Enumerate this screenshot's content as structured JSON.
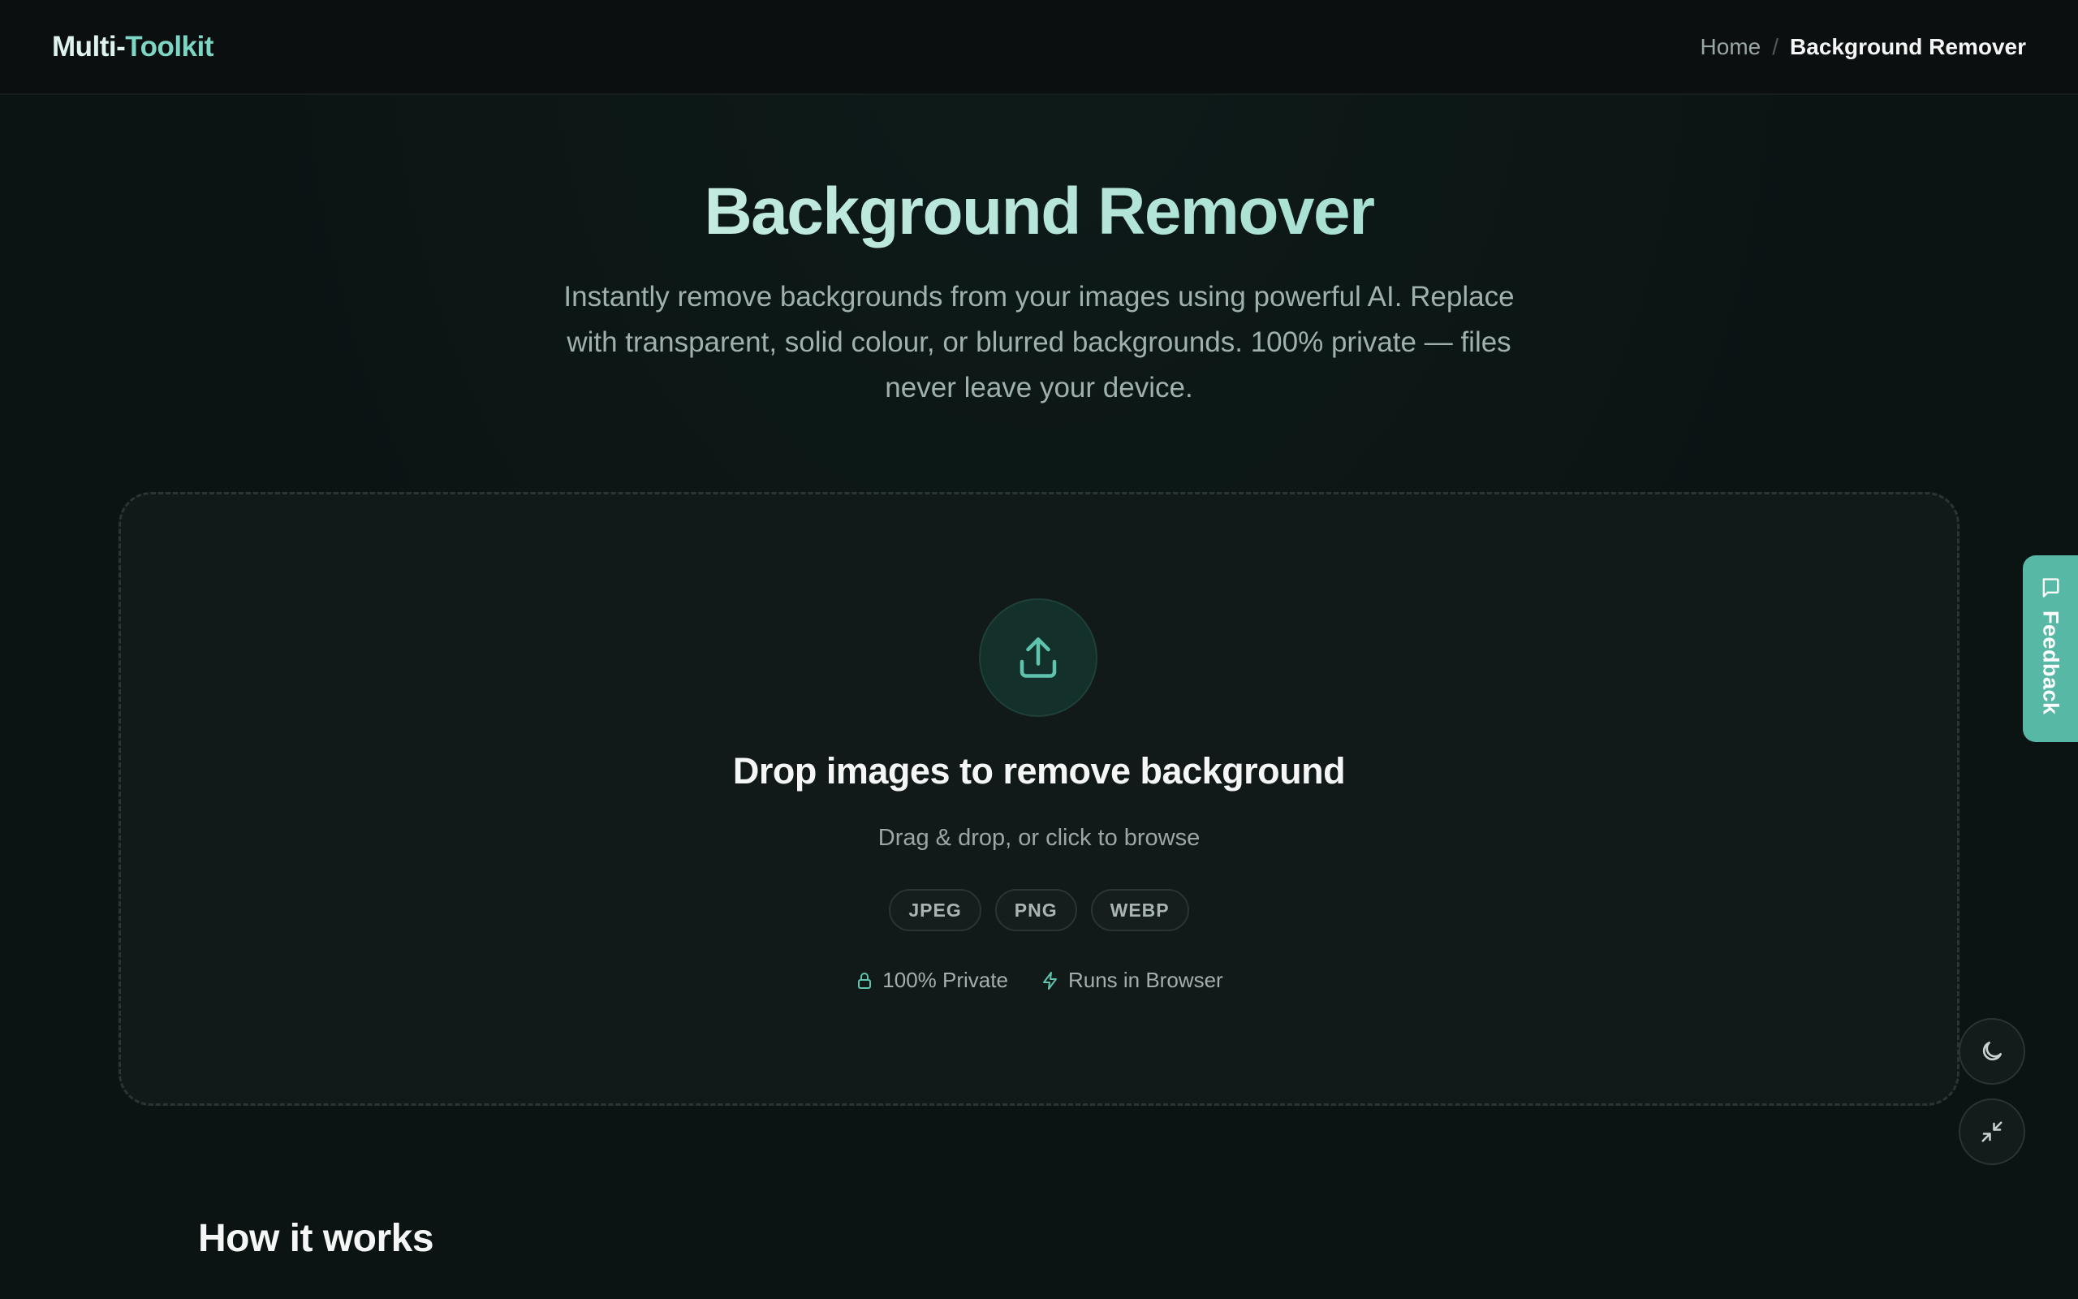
{
  "header": {
    "brand_part1": "Multi-",
    "brand_part2": "Toolkit",
    "breadcrumb": {
      "home": "Home",
      "separator": "/",
      "current": "Background Remover"
    }
  },
  "hero": {
    "title": "Background Remover",
    "subtitle": "Instantly remove backgrounds from your images using powerful AI. Replace with transparent, solid colour, or blurred backgrounds. 100% private — files never leave your device."
  },
  "dropzone": {
    "icon": "upload-icon",
    "title": "Drop images to remove background",
    "hint": "Drag & drop, or click to browse",
    "formats": [
      "JPEG",
      "PNG",
      "WEBP"
    ],
    "badges": [
      {
        "icon": "lock-icon",
        "label": "100% Private"
      },
      {
        "icon": "lightning-icon",
        "label": "Runs in Browser"
      }
    ]
  },
  "feedback": {
    "label": "Feedback",
    "icon": "message-square-icon"
  },
  "floating_buttons": {
    "theme_icon": "moon-icon",
    "collapse_icon": "minimize-icon"
  },
  "sections": {
    "how_it_works": "How it works"
  },
  "colors": {
    "accent": "#58b8a6",
    "background": "#0b1413",
    "header_bg": "#0b0f10",
    "dropzone_bg": "#121a19"
  }
}
